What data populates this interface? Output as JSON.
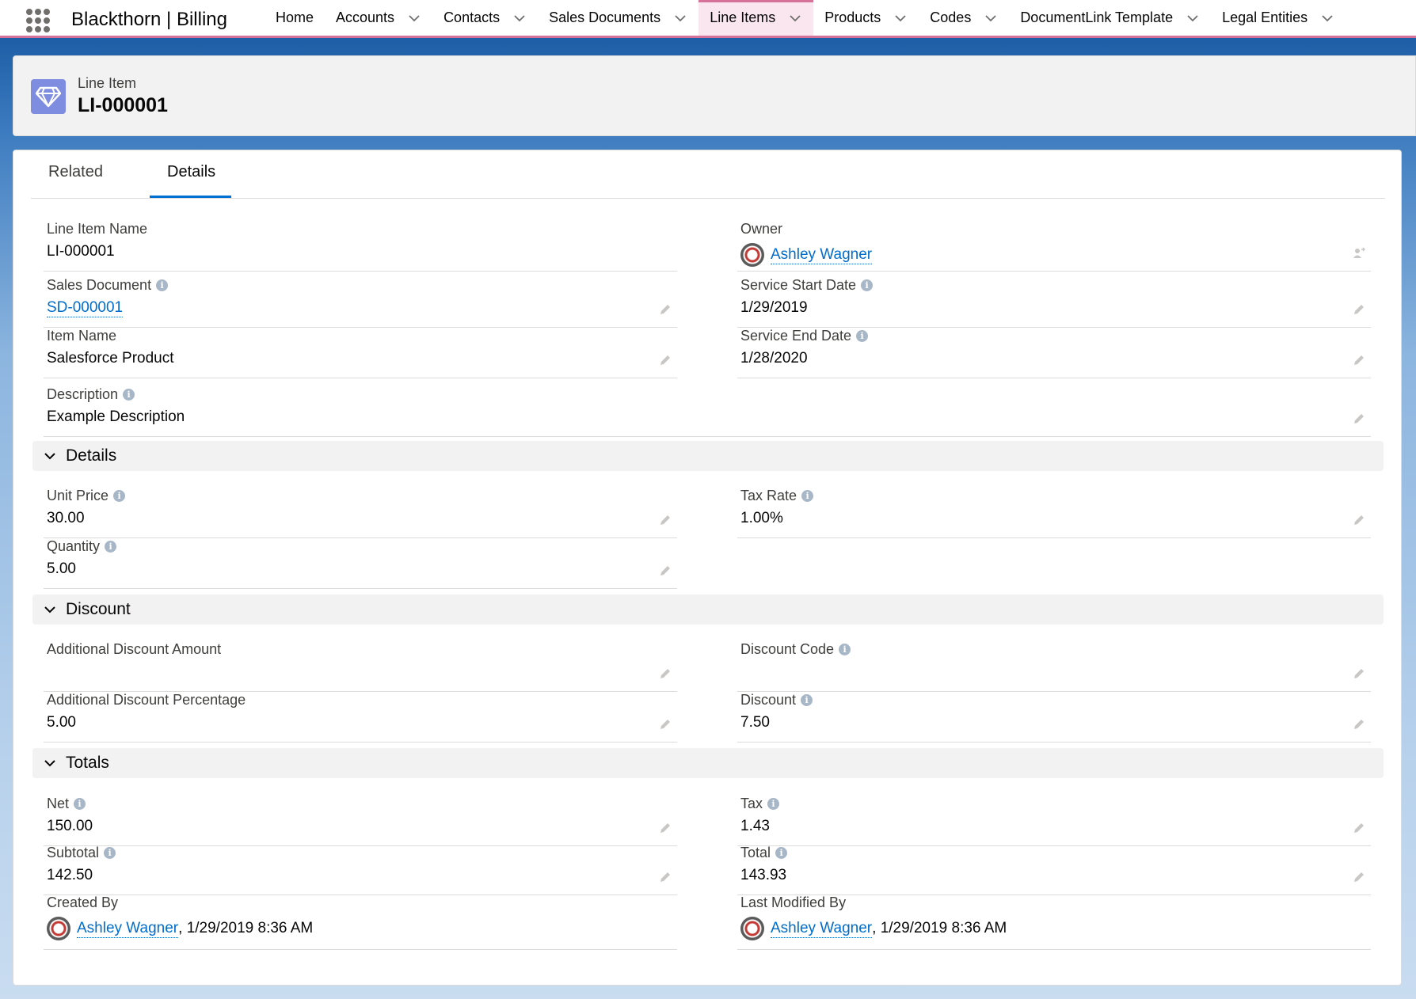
{
  "app": {
    "name": "Blackthorn | Billing"
  },
  "nav": {
    "items": [
      {
        "label": "Home",
        "dropdown": false,
        "active": false
      },
      {
        "label": "Accounts",
        "dropdown": true,
        "active": false
      },
      {
        "label": "Contacts",
        "dropdown": true,
        "active": false
      },
      {
        "label": "Sales Documents",
        "dropdown": true,
        "active": false
      },
      {
        "label": "Line Items",
        "dropdown": true,
        "active": true
      },
      {
        "label": "Products",
        "dropdown": true,
        "active": false
      },
      {
        "label": "Codes",
        "dropdown": true,
        "active": false
      },
      {
        "label": "DocumentLink Template",
        "dropdown": true,
        "active": false
      },
      {
        "label": "Legal Entities",
        "dropdown": true,
        "active": false
      }
    ],
    "accent_color": "#d6729a"
  },
  "record": {
    "type_label": "Line Item",
    "title": "LI-000001",
    "icon": "diamond-icon",
    "icon_color": "#7f8de1"
  },
  "tabs": {
    "related": "Related",
    "details": "Details",
    "active": "Details"
  },
  "fields": {
    "line_item_name": {
      "label": "Line Item Name",
      "value": "LI-000001"
    },
    "owner": {
      "label": "Owner",
      "value": "Ashley Wagner"
    },
    "sales_document": {
      "label": "Sales Document",
      "value": "SD-000001"
    },
    "service_start_date": {
      "label": "Service Start Date",
      "value": "1/29/2019"
    },
    "item_name": {
      "label": "Item Name",
      "value": "Salesforce Product"
    },
    "service_end_date": {
      "label": "Service End Date",
      "value": "1/28/2020"
    },
    "description": {
      "label": "Description",
      "value": "Example Description"
    },
    "unit_price": {
      "label": "Unit Price",
      "value": "30.00"
    },
    "tax_rate": {
      "label": "Tax Rate",
      "value": "1.00%"
    },
    "quantity": {
      "label": "Quantity",
      "value": "5.00"
    },
    "additional_discount_amount": {
      "label": "Additional Discount Amount",
      "value": ""
    },
    "discount_code": {
      "label": "Discount Code",
      "value": ""
    },
    "additional_discount_percentage": {
      "label": "Additional Discount Percentage",
      "value": "5.00"
    },
    "discount": {
      "label": "Discount",
      "value": "7.50"
    },
    "net": {
      "label": "Net",
      "value": "150.00"
    },
    "tax": {
      "label": "Tax",
      "value": "1.43"
    },
    "subtotal": {
      "label": "Subtotal",
      "value": "142.50"
    },
    "total": {
      "label": "Total",
      "value": "143.93"
    },
    "created_by": {
      "label": "Created By",
      "user": "Ashley Wagner",
      "timestamp": ", 1/29/2019 8:36 AM"
    },
    "last_modified_by": {
      "label": "Last Modified By",
      "user": "Ashley Wagner",
      "timestamp": ", 1/29/2019 8:36 AM"
    }
  },
  "sections": {
    "details": "Details",
    "discount": "Discount",
    "totals": "Totals"
  },
  "colors": {
    "link": "#006dcc",
    "tab_active": "#0070d2"
  }
}
